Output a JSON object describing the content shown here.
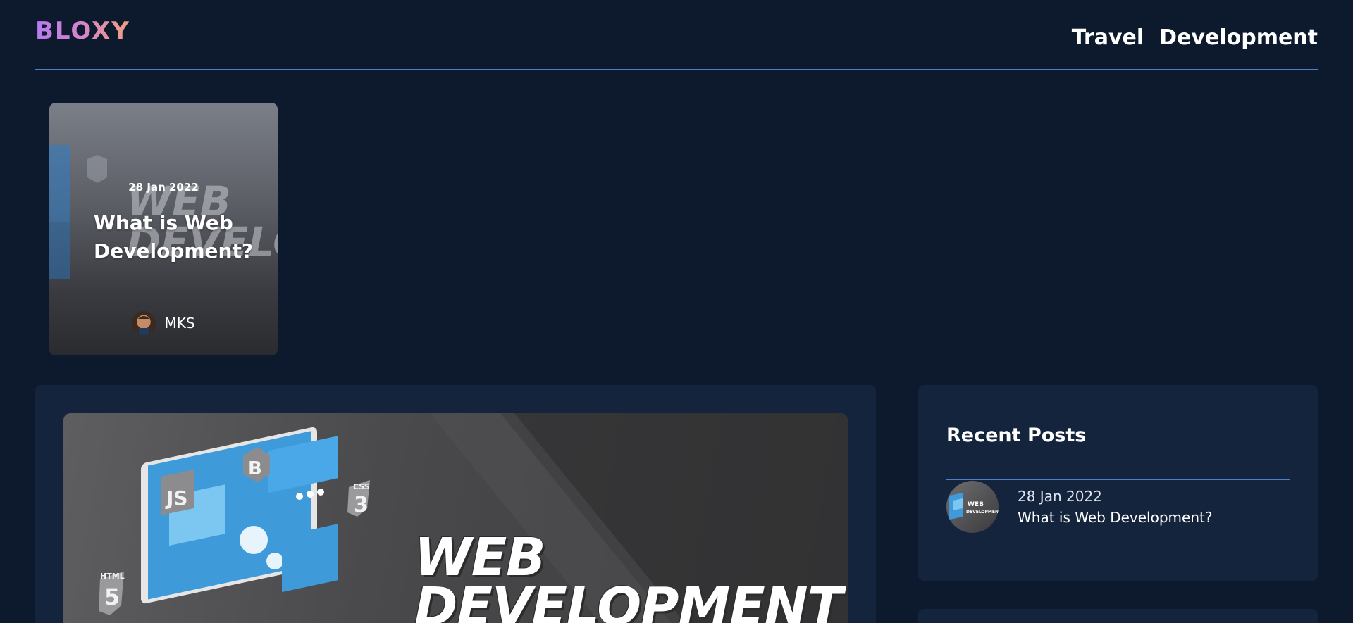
{
  "brand": {
    "logo": "BLOXY",
    "gradient": [
      "#b57bf0",
      "#f0a080"
    ]
  },
  "nav": {
    "items": [
      "Travel",
      "Development"
    ]
  },
  "hero": {
    "date": "28 Jan 2022",
    "title": "What is Web Development?",
    "author": "MKS",
    "image_text": "WEB DEVELO"
  },
  "main": {
    "image_title_line1": "WEB",
    "image_title_line2": "DEVELOPMENT",
    "icon_labels": [
      "JS",
      "B",
      "CSS",
      "HTML"
    ]
  },
  "sidebar": {
    "heading": "Recent Posts",
    "recent": [
      {
        "date": "28 Jan 2022",
        "title": "What is Web Development?",
        "thumb_text": "WEB DEVELOPMENT"
      }
    ]
  },
  "colors": {
    "background": "#0d1a2e",
    "panel": "#15243d",
    "divider": "#4f7fc6",
    "text": "#ffffff"
  }
}
